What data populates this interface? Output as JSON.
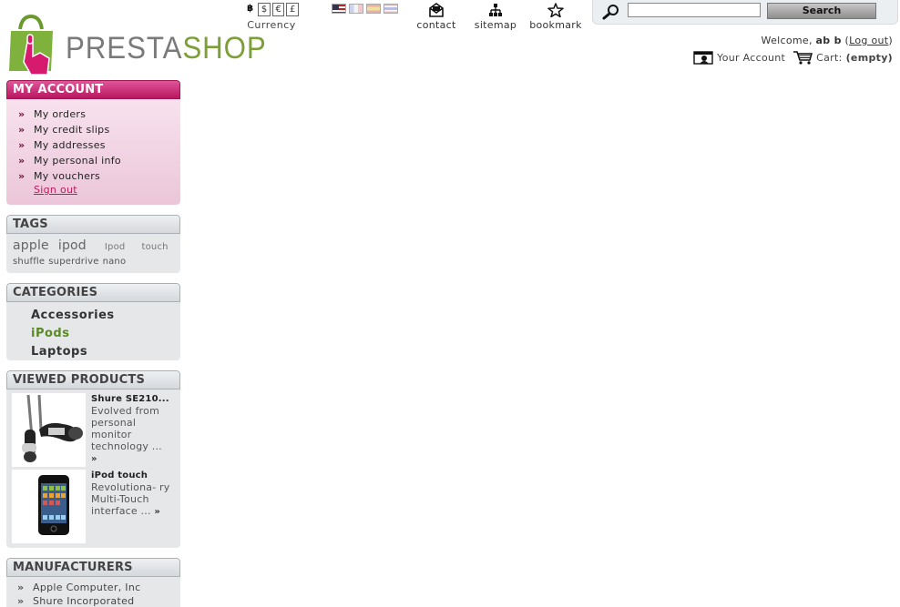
{
  "logo": {
    "brand_part1": "PRESTA",
    "brand_part2": "SHOP"
  },
  "currency": {
    "symbols": [
      "฿",
      "$",
      "€",
      "£"
    ],
    "selected": "฿",
    "label": "Currency"
  },
  "languages": [
    {
      "code": "us",
      "icon": "flag-us-icon"
    },
    {
      "code": "fr",
      "icon": "flag-fr-icon"
    },
    {
      "code": "es",
      "icon": "flag-es-icon"
    },
    {
      "code": "th",
      "icon": "flag-th-icon"
    }
  ],
  "permalinks": {
    "contact": "contact",
    "sitemap": "sitemap",
    "bookmark": "bookmark"
  },
  "search": {
    "value": "",
    "placeholder": "",
    "button_label": "Search"
  },
  "user_info": {
    "welcome_prefix": "Welcome,",
    "customer_name": "ab b",
    "open_paren": "(",
    "logout_label": "Log out",
    "close_paren": ")",
    "your_account": "Your Account",
    "cart_label": "Cart:",
    "cart_status": "(empty)"
  },
  "my_account": {
    "title": "MY ACCOUNT",
    "items": [
      {
        "label": "My orders"
      },
      {
        "label": "My credit slips"
      },
      {
        "label": "My addresses"
      },
      {
        "label": "My personal info"
      },
      {
        "label": "My vouchers"
      }
    ],
    "sign_out": "Sign out"
  },
  "tags": {
    "title": "TAGS",
    "items": [
      "apple",
      "ipod",
      "Ipod",
      "touch",
      "shuffle",
      "superdrive",
      "nano"
    ]
  },
  "categories": {
    "title": "CATEGORIES",
    "items": [
      {
        "label": "Accessories",
        "selected": false
      },
      {
        "label": "iPods",
        "selected": true
      },
      {
        "label": "Laptops",
        "selected": false
      }
    ],
    "selected_color": "#5a8a24"
  },
  "viewed_products": {
    "title": "VIEWED PRODUCTS",
    "items": [
      {
        "name": "Shure SE210...",
        "description": "Evolved from personal monitor technology ...",
        "more": "»"
      },
      {
        "name": "iPod touch",
        "description": "Revolutiona- ry Multi-Touch interface ...",
        "more": "»"
      }
    ]
  },
  "manufacturers": {
    "title": "MANUFACTURERS",
    "items": [
      "Apple Computer, Inc",
      "Shure Incorporated"
    ]
  },
  "colors": {
    "accent": "#c2185b",
    "brand_green": "#7ca037"
  }
}
